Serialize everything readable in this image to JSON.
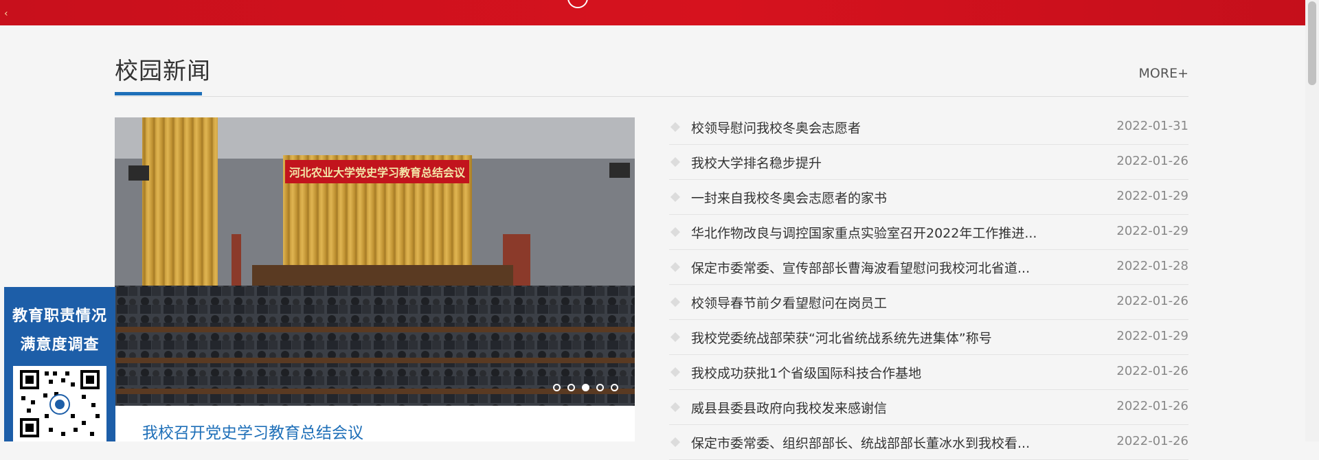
{
  "section": {
    "title": "校园新闻",
    "more_label": "MORE+"
  },
  "feature": {
    "banner_text": "河北农业大学党史学习教育总结会议",
    "caption": "我校召开党史学习教育总结会议",
    "slides": 5,
    "active_slide": 3
  },
  "news": [
    {
      "title": "校领导慰问我校冬奥会志愿者",
      "date": "2022-01-31"
    },
    {
      "title": "我校大学排名稳步提升",
      "date": "2022-01-26"
    },
    {
      "title": "一封来自我校冬奥会志愿者的家书",
      "date": "2022-01-29"
    },
    {
      "title": "华北作物改良与调控国家重点实验室召开2022年工作推进...",
      "date": "2022-01-29"
    },
    {
      "title": "保定市委常委、宣传部部长曹海波看望慰问我校河北省道...",
      "date": "2022-01-28"
    },
    {
      "title": "校领导春节前夕看望慰问在岗员工",
      "date": "2022-01-26"
    },
    {
      "title": "我校党委统战部荣获“河北省统战系统先进集体”称号",
      "date": "2022-01-29"
    },
    {
      "title": "我校成功获批1个省级国际科技合作基地",
      "date": "2022-01-26"
    },
    {
      "title": "威县县委县政府向我校发来感谢信",
      "date": "2022-01-26"
    },
    {
      "title": "保定市委常委、组织部部长、统战部部长董冰水到我校看...",
      "date": "2022-01-26"
    }
  ],
  "survey": {
    "line1": "教育职责情况",
    "line2": "满意度调查"
  },
  "colors": {
    "brand_red": "#d6121e",
    "accent_blue": "#1e6fb8",
    "survey_blue": "#1d5ea8"
  }
}
